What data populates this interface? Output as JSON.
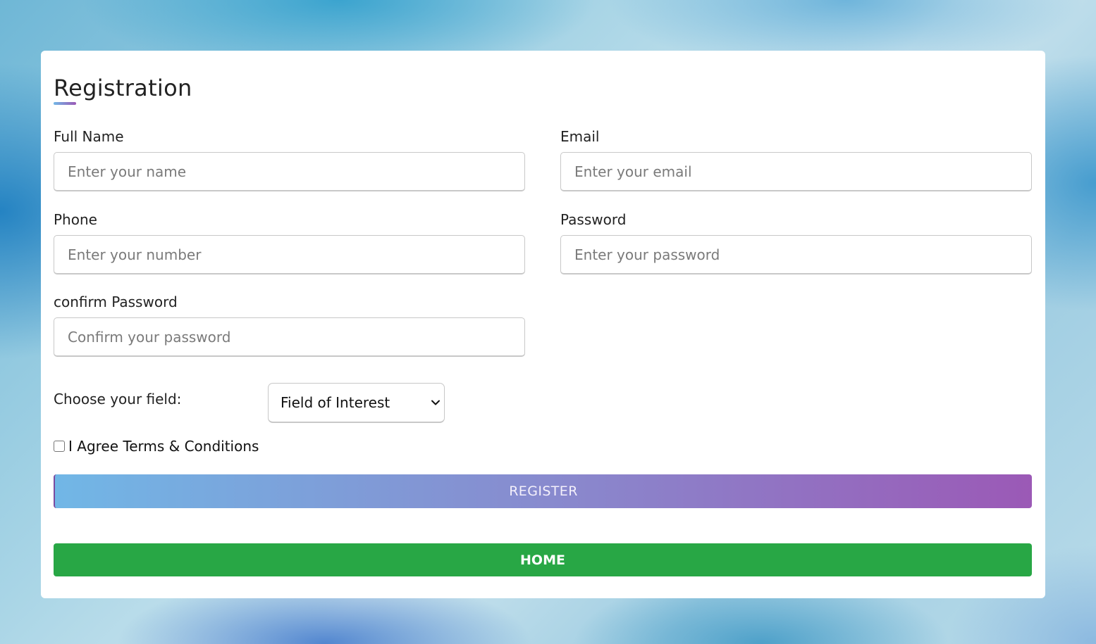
{
  "form": {
    "title": "Registration",
    "fields": {
      "full_name": {
        "label": "Full Name",
        "placeholder": "Enter your name",
        "value": ""
      },
      "email": {
        "label": "Email",
        "placeholder": "Enter your email",
        "value": ""
      },
      "phone": {
        "label": "Phone",
        "placeholder": "Enter your number",
        "value": ""
      },
      "password": {
        "label": "Password",
        "placeholder": "Enter your password",
        "value": ""
      },
      "confirm_password": {
        "label": "confirm Password",
        "placeholder": "Confirm your password",
        "value": ""
      }
    },
    "field_select": {
      "label": "Choose your field:",
      "selected": "Field of Interest"
    },
    "terms": {
      "label": "I Agree Terms & Conditions",
      "checked": false
    },
    "register_label": "REGISTER",
    "home_label": "HOME"
  },
  "colors": {
    "accent_start": "#71b7e6",
    "accent_end": "#9b59b6",
    "home_green": "#28a745",
    "card_background": "#ffffff"
  },
  "icons": {
    "select_arrow": "chevron-down-icon"
  }
}
